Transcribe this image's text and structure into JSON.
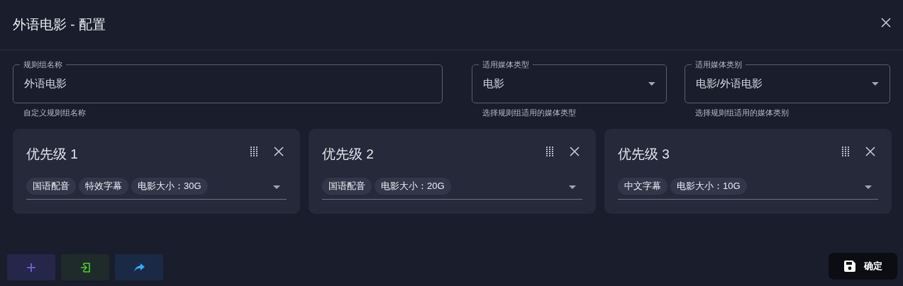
{
  "dialog": {
    "title": "外语电影 - 配置"
  },
  "fields": [
    {
      "kind": "text",
      "label": "规则组名称",
      "value": "外语电影",
      "hint": "自定义规则组名称"
    },
    {
      "kind": "select",
      "label": "适用媒体类型",
      "value": "电影",
      "hint": "选择规则组适用的媒体类型"
    },
    {
      "kind": "select",
      "label": "适用媒体类别",
      "value": "电影/外语电影",
      "hint": "选择规则组适用的媒体类别"
    }
  ],
  "priorities": [
    {
      "title": "优先级 1",
      "tags": [
        "国语配音",
        "特效字幕",
        "电影大小：30G"
      ]
    },
    {
      "title": "优先级 2",
      "tags": [
        "国语配音",
        "电影大小：20G"
      ]
    },
    {
      "title": "优先级 3",
      "tags": [
        "中文字幕",
        "电影大小：10G"
      ]
    }
  ],
  "actions": [
    {
      "kind": "add"
    },
    {
      "kind": "import"
    },
    {
      "kind": "share"
    }
  ],
  "confirm": {
    "label": "确定"
  }
}
